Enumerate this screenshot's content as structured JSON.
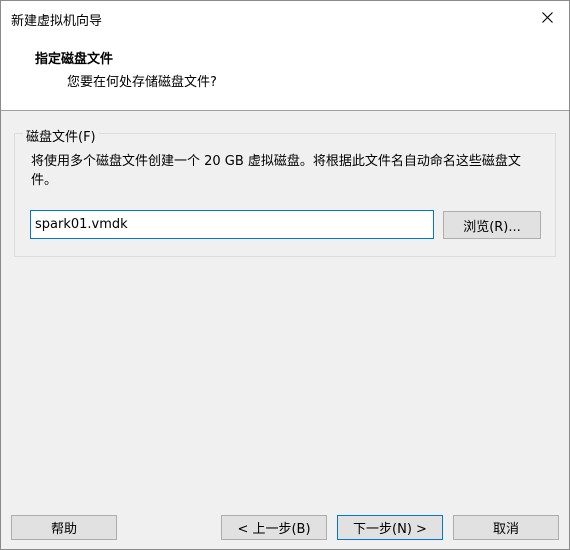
{
  "window": {
    "title": "新建虚拟机向导"
  },
  "header": {
    "title": "指定磁盘文件",
    "subtitle": "您要在何处存储磁盘文件?"
  },
  "disk_file_group": {
    "label": "磁盘文件(F)",
    "description": "将使用多个磁盘文件创建一个 20 GB 虚拟磁盘。将根据此文件名自动命名这些磁盘文件。",
    "filename_value": "spark01.vmdk",
    "browse_label": "浏览(R)..."
  },
  "footer": {
    "help_label": "帮助",
    "back_label": "< 上一步(B)",
    "next_label": "下一步(N) >",
    "cancel_label": "取消"
  },
  "icons": {
    "close": "close-icon"
  }
}
